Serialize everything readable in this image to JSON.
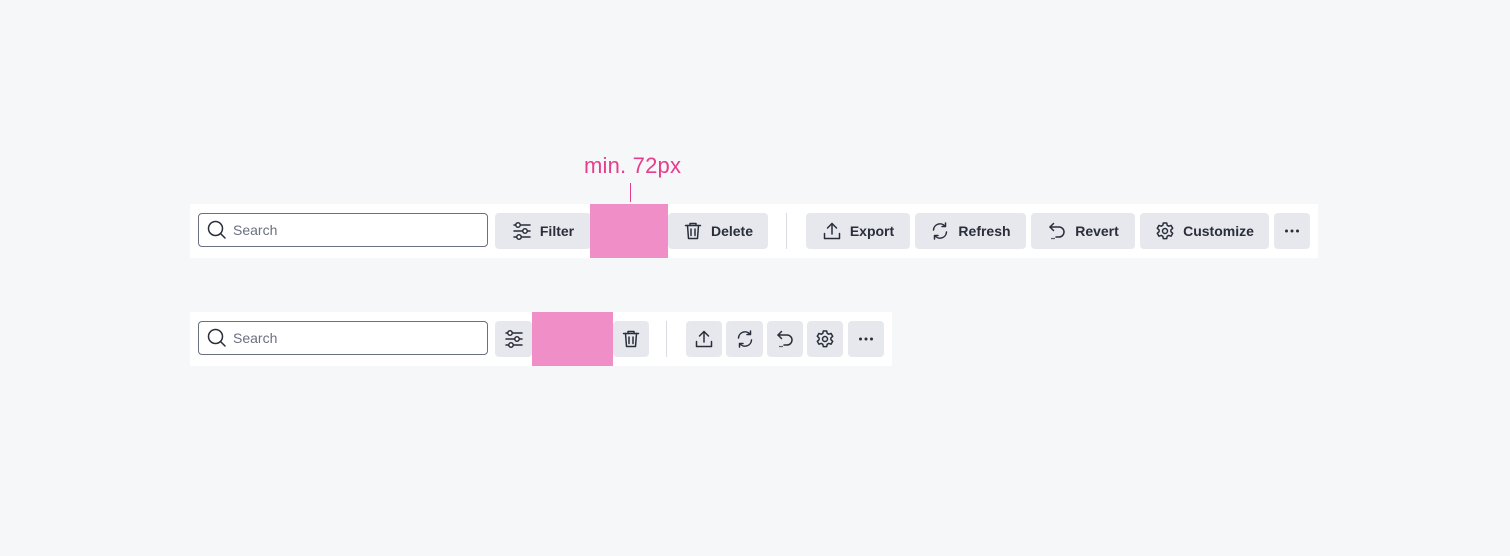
{
  "annotation": {
    "label": "min. 72px",
    "color": "#e63d8c",
    "highlight_color": "#f08ec8"
  },
  "toolbar_full": {
    "search": {
      "placeholder": "Search",
      "value": ""
    },
    "filter_label": "Filter",
    "delete_label": "Delete",
    "export_label": "Export",
    "refresh_label": "Refresh",
    "revert_label": "Revert",
    "customize_label": "Customize",
    "more_icon": "more-icon"
  },
  "toolbar_compact": {
    "search": {
      "placeholder": "Search",
      "value": ""
    },
    "icons": [
      "filter-icon",
      "delete-icon",
      "export-icon",
      "refresh-icon",
      "revert-icon",
      "customize-icon",
      "more-icon"
    ]
  },
  "colors": {
    "page_bg": "#f6f7f9",
    "toolbar_bg": "#ffffff",
    "button_bg": "#e6e8ed",
    "text": "#2a2e3a"
  }
}
